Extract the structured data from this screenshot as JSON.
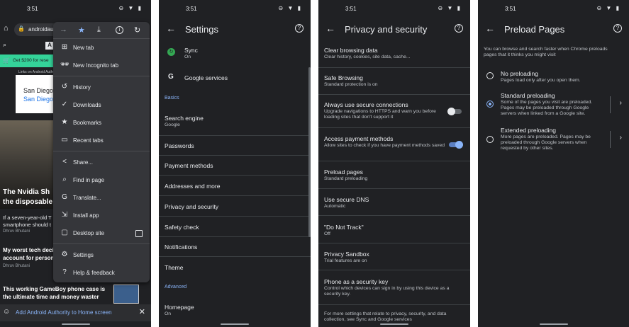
{
  "status": {
    "time": "3:51",
    "icons": "⊖ ▼ ▮"
  },
  "phone1": {
    "url": "androidau",
    "promo": "Get $200 for rese",
    "ad_caption": "Links on Android Authority",
    "ad_text1": "San Diego",
    "ad_text2": "San Diego",
    "headline1": "The Nvidia Sh",
    "headline1b": "the disposable",
    "teaser1": "If a seven-year-old T",
    "teaser1b": "smartphone should t",
    "author1": "Dhruv Bhutani",
    "headline2": "My worst tech deci",
    "headline2b": "account for person",
    "author2": "Dhruv Bhutani",
    "headline3": "This working GameBoy phone case is",
    "headline3b": "the ultimate time and money waster",
    "bottom_banner": "Add Android Authority to Home screen",
    "menu": {
      "items": [
        {
          "icon": "⊞",
          "label": "New tab"
        },
        {
          "icon": "🕶",
          "label": "New Incognito tab"
        },
        {
          "icon": "↺",
          "label": "History"
        },
        {
          "icon": "✓",
          "label": "Downloads"
        },
        {
          "icon": "★",
          "label": "Bookmarks"
        },
        {
          "icon": "▭",
          "label": "Recent tabs"
        },
        {
          "icon": "<",
          "label": "Share..."
        },
        {
          "icon": "⌕",
          "label": "Find in page"
        },
        {
          "icon": "G",
          "label": "Translate..."
        },
        {
          "icon": "⇲",
          "label": "Install app"
        },
        {
          "icon": "▢",
          "label": "Desktop site"
        },
        {
          "icon": "⚙",
          "label": "Settings"
        },
        {
          "icon": "?",
          "label": "Help & feedback"
        }
      ]
    }
  },
  "phone2": {
    "title": "Settings",
    "sync_title": "Sync",
    "sync_sub": "On",
    "google_services": "Google services",
    "section_basics": "Basics",
    "search_engine": "Search engine",
    "search_engine_sub": "Google",
    "passwords": "Passwords",
    "payment_methods": "Payment methods",
    "addresses": "Addresses and more",
    "privacy": "Privacy and security",
    "safety_check": "Safety check",
    "notifications": "Notifications",
    "theme": "Theme",
    "section_advanced": "Advanced",
    "homepage": "Homepage",
    "homepage_sub": "On"
  },
  "phone3": {
    "title": "Privacy and security",
    "items": [
      {
        "title": "Clear browsing data",
        "sub": "Clear history, cookies, site data, cache..."
      },
      {
        "title": "Safe Browsing",
        "sub": "Standard protection is on"
      },
      {
        "title": "Always use secure connections",
        "sub": "Upgrade navigations to HTTPS and warn you before loading sites that don't support it"
      },
      {
        "title": "Access payment methods",
        "sub": "Allow sites to check if you have payment methods saved"
      },
      {
        "title": "Preload pages",
        "sub": "Standard preloading"
      },
      {
        "title": "Use secure DNS",
        "sub": "Automatic"
      },
      {
        "title": "\"Do Not Track\"",
        "sub": "Off"
      },
      {
        "title": "Privacy Sandbox",
        "sub": "Trial features are on"
      },
      {
        "title": "Phone as a security key",
        "sub": "Control which devices can sign in by using this device as a security key."
      }
    ],
    "footer": "For more settings that relate to privacy, security, and data collection, see Sync and Google services"
  },
  "phone4": {
    "title": "Preload Pages",
    "intro": "You can browse and search faster when Chrome preloads pages that it thinks you might visit",
    "options": [
      {
        "title": "No preloading",
        "sub": "Pages load only after you open them."
      },
      {
        "title": "Standard preloading",
        "sub": "Some of the pages you visit are preloaded. Pages may be preloaded through Google servers when linked from a Google site."
      },
      {
        "title": "Extended preloading",
        "sub": "More pages are preloaded. Pages may be preloaded through Google servers when requested by other sites."
      }
    ]
  },
  "colors": {
    "bg": "#202124",
    "accent": "#8ab4f8",
    "promo": "#34d399"
  }
}
